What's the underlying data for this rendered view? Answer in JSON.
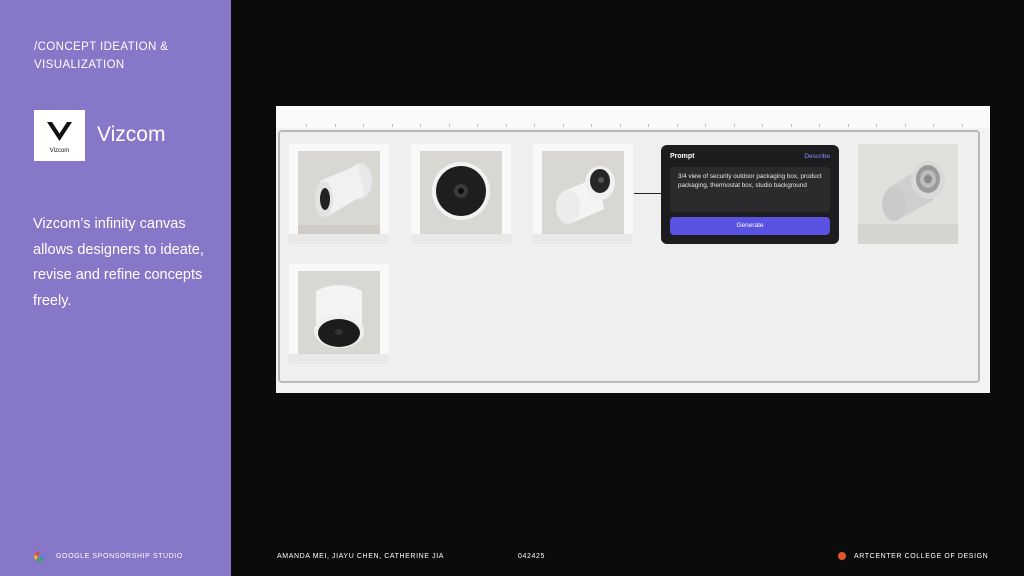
{
  "sidebar": {
    "section_title": "/CONCEPT IDEATION & VISUALIZATION",
    "logo_word": "Vizcom",
    "brand_name": "Vizcom",
    "description": "Vizcom’s infinity canvas allows designers to ideate, revise and refine concepts freely."
  },
  "canvas": {
    "prompt_card": {
      "title": "Prompt",
      "describe_label": "Describe",
      "prompt_text": "3/4 view of security outdoor packaging box, product packaging, thermostat box, studio background",
      "generate_label": "Generate"
    }
  },
  "footer": {
    "left": "GOOGLE SPONSORSHIP STUDIO",
    "authors": "AMANDA MEI, JIAYU CHEN, CATHERINE JIA",
    "date": "042425",
    "right": "ARTCENTER COLLEGE OF DESIGN"
  },
  "colors": {
    "sidebar_bg": "#8677c9",
    "accent_button": "#5a52e0",
    "describe_link": "#8c86ff",
    "footer_dot": "#e4572e"
  }
}
